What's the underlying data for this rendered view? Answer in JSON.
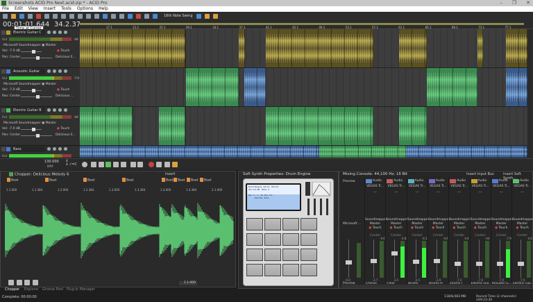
{
  "window": {
    "title": "Screenshots ACID Pro Next.acid-zip * - ACID Pro",
    "controls": [
      "–",
      "❐",
      "✕"
    ]
  },
  "menu": [
    "File",
    "Edit",
    "View",
    "Insert",
    "Tools",
    "Options",
    "Help"
  ],
  "toolbar": {
    "swing": "16th Note Swing"
  },
  "time": {
    "timecode": "00:01:01.644",
    "tooltip": "Time at Cursor",
    "position": "34.2.377"
  },
  "ruler": [
    "17.1",
    "21.1",
    "25.1",
    "29.1",
    "33.1",
    "37.1",
    "41.1",
    "45.1",
    "49.1",
    "53.1",
    "57.1",
    "61.1",
    "65.1",
    "69.1",
    "73.1",
    "77.1"
  ],
  "tracks": [
    {
      "name": "Electric Guitar C",
      "color": "#b0a030",
      "device": "Microsoft Soundmapper",
      "bus": "Master",
      "volume": "-7.0 dB",
      "pan": "Center",
      "automation": "Touch",
      "plugin": "Delicious E...",
      "peak": "-Inf.",
      "live": false
    },
    {
      "name": "Acoustic Guitar",
      "color": "#4a7ad0",
      "device": "Microsoft Soundmapper",
      "bus": "Master",
      "volume": "-7.0 dB",
      "pan": "Center",
      "automation": "Touch",
      "plugin": "Delicious ...",
      "peak": "-7.9",
      "live": true
    },
    {
      "name": "Electric Guitar B",
      "color": "#4ac060",
      "device": "Microsoft Soundmapper",
      "bus": "Master",
      "volume": "-7.0 dB",
      "pan": "Center",
      "automation": "Touch",
      "plugin": "Delicious E...",
      "peak": "-Inf.",
      "live": false
    },
    {
      "name": "Bass",
      "color": "#4a7ad0",
      "live": true
    }
  ],
  "labels": {
    "out": "Out",
    "vol": "Vol:",
    "pan": "Pan:"
  },
  "transport": {
    "tempo": "130.000",
    "tempo_unit": "BPM",
    "time_sig_top": "4",
    "time_sig_bottom": "4",
    "key": "C"
  },
  "chopper": {
    "title": "Chopper: Delicious Melody 6",
    "insert": "Insert",
    "markers": [
      "Beat",
      "Beat",
      "Beat",
      "Beat",
      "Beat",
      "Beat",
      "Beat",
      "Beat"
    ],
    "ruler": [
      "1.1.000",
      "1.1.384",
      "1.2.000",
      "1.2.384",
      "1.3.000",
      "1.3.384",
      "1.4.000",
      "1.4.384",
      "2.1.000"
    ],
    "position": "1.1.000"
  },
  "panel_tabs": [
    "Chopper",
    "Explorer",
    "Groove Pool",
    "Plug-In Manager"
  ],
  "synth": {
    "title": "Soft Synth Properties: Drum Engine",
    "lcd": "Drum Engine  Kit 01   Pad 13\nVol  0.0 dB   Pitch  0\n\nPan  C   1 - 16  Dec 1.0\n         Velocity  Tune"
  },
  "mixer": {
    "title": "Mixing Console: 44,100 Hz; 16 Bit",
    "insert_bus": "Insert Input Bus",
    "insert_synth": "Insert Soft Synth...",
    "preview": {
      "label": "Preview",
      "device": "Microsoft ...",
      "db": "-6.0",
      "name": "Preview"
    },
    "channels": [
      {
        "type": "Audio",
        "plugin": "VEGAS Tr...",
        "dash": "---",
        "out": "Soundmapper",
        "bus": "Master",
        "auto": "Touch",
        "pan": "Center",
        "db": "-3.7",
        "peak": "-Inf.",
        "name": "Chorus",
        "color": "#5a8ad0",
        "level": 0
      },
      {
        "type": "Audio",
        "plugin": "VEGAS Tr...",
        "dash": "---",
        "out": "Soundmapper",
        "bus": "Master",
        "auto": "Touch",
        "pan": "Center",
        "db": "3.0",
        "peak": "-3.8",
        "name": "Choir",
        "color": "#c06060",
        "level": 0.85
      },
      {
        "type": "Audio",
        "plugin": "VEGAS Tr...",
        "dash": "---",
        "out": "Soundmapper",
        "bus": "Master",
        "auto": "Touch",
        "pan": "Center",
        "db": "-4.5",
        "peak": "-4.5",
        "name": "Drums",
        "color": "#60b0c0",
        "level": 0.82
      },
      {
        "type": "Audio",
        "plugin": "VEGAS Tr...",
        "dash": "---",
        "out": "Soundmapper",
        "bus": "Master",
        "auto": "Touch",
        "pan": "Center",
        "db": "-3.9",
        "peak": "-Inf.",
        "name": "Drums H",
        "color": "#7a6ac0",
        "level": 0
      },
      {
        "type": "Audio",
        "plugin": "VEGAS Tr...",
        "dash": "---",
        "out": "Soundmapper",
        "bus": "Master",
        "auto": "Touch",
        "pan": "Center",
        "db": "-7.0",
        "peak": "-Inf.",
        "name": "Drums I",
        "color": "#c05a5a",
        "level": 0
      },
      {
        "type": "Audio",
        "plugin": "VEGAS Tr...",
        "dash": "---",
        "out": "Soundmapper",
        "bus": "Master",
        "auto": "Touch",
        "pan": "Center",
        "db": "-7.0",
        "peak": "-Inf.",
        "name": "Electric Gui...",
        "color": "#c0a030",
        "level": 0
      },
      {
        "type": "Audio",
        "plugin": "VEGAS Tr...",
        "dash": "---",
        "out": "Soundmapper",
        "bus": "Master",
        "auto": "Touch",
        "pan": "Center",
        "db": "-7.0",
        "peak": "-7.9",
        "name": "Acoustic G...",
        "color": "#5a7ad0",
        "level": 0.78
      },
      {
        "type": "Audio",
        "plugin": "VEGAS Tr...",
        "dash": "---",
        "out": "Soundmapper",
        "bus": "Master",
        "auto": "Touch",
        "pan": "Center",
        "db": "-7.0",
        "peak": "-Inf.",
        "name": "Electric Gui...",
        "color": "#60c070",
        "level": 0
      }
    ]
  },
  "status": {
    "left": "Complete: 00:00:00",
    "memory": "118/8,083 MB",
    "record": "Record Time (2 channels): 249:23:30"
  }
}
